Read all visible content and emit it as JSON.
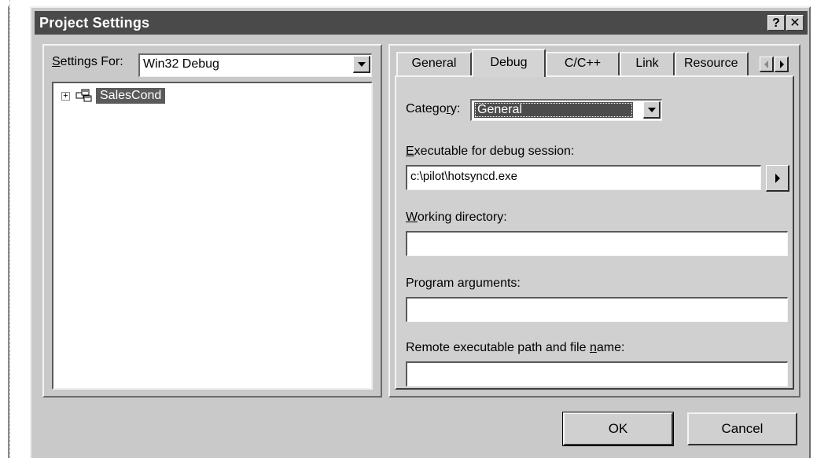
{
  "window": {
    "title": "Project Settings",
    "help_glyph": "?",
    "close_glyph": "✕"
  },
  "left": {
    "settings_for_label_prefix": "S",
    "settings_for_label_rest": "ettings For:",
    "settings_for_value": "Win32 Debug",
    "tree": {
      "expander_glyph": "+",
      "project_name": "SalesCond"
    }
  },
  "tabs": [
    {
      "label": "General"
    },
    {
      "label": "Debug"
    },
    {
      "label": "C/C++"
    },
    {
      "label": "Link"
    },
    {
      "label": "Resource"
    }
  ],
  "debug": {
    "category_label_pre": "Catego",
    "category_label_u": "r",
    "category_label_post": "y:",
    "category_value": "General",
    "executable_label_u": "E",
    "executable_label_rest": "xecutable for debug session:",
    "executable_value": "c:\\pilot\\hotsyncd.exe",
    "working_dir_label_u": "W",
    "working_dir_label_rest": "orking directory:",
    "working_dir_value": "",
    "program_args_label_pre": "Program ar",
    "program_args_label_u": "g",
    "program_args_label_post": "uments:",
    "program_args_value": "",
    "remote_label_pre": "Remote executable path and file ",
    "remote_label_u": "n",
    "remote_label_post": "ame:",
    "remote_value": ""
  },
  "buttons": {
    "ok": "OK",
    "cancel": "Cancel"
  },
  "icons": {
    "help": "help-icon",
    "close": "close-icon",
    "dropdown": "chevron-down-icon",
    "project": "project-icon",
    "scroll_left": "scroll-left-icon",
    "scroll_right": "scroll-right-icon",
    "browse": "browse-arrow-icon"
  },
  "colors": {
    "dialog_bg": "#c9c9c9",
    "titlebar_bg": "#4a4a4a",
    "selection_bg": "#5a5a5a"
  }
}
